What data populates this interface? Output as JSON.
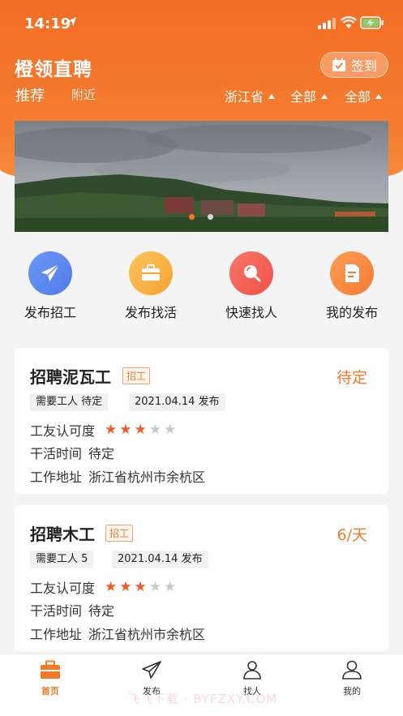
{
  "status_bar": {
    "time": "14:19"
  },
  "header": {
    "app_title": "橙领直聘",
    "checkin_label": "签到",
    "tabs": {
      "recommend": "推荐",
      "nearby": "附近"
    },
    "filters": {
      "province": "浙江省",
      "city": "全部",
      "district": "全部"
    }
  },
  "quick_actions": [
    {
      "label": "发布招工",
      "icon": "paper-plane-icon"
    },
    {
      "label": "发布找活",
      "icon": "briefcase-icon"
    },
    {
      "label": "快速找人",
      "icon": "search-icon"
    },
    {
      "label": "我的发布",
      "icon": "document-icon"
    }
  ],
  "jobs": [
    {
      "title": "招聘泥瓦工",
      "tag": "招工",
      "pay": "待定",
      "workers_needed": "需要工人 待定",
      "published": "2021.04.14 发布",
      "rating_label": "工友认可度",
      "rating": 3,
      "rating_max": 5,
      "time_label": "干活时间",
      "time_value": "待定",
      "addr_label": "工作地址",
      "addr_value": "浙江省杭州市余杭区"
    },
    {
      "title": "招聘木工",
      "tag": "招工",
      "pay": "6/天",
      "workers_needed": "需要工人 5",
      "published": "2021.04.14 发布",
      "rating_label": "工友认可度",
      "rating": 3,
      "rating_max": 5,
      "time_label": "干活时间",
      "time_value": "待定",
      "addr_label": "工作地址",
      "addr_value": "浙江省杭州市余杭区"
    }
  ],
  "tabbar": {
    "home": "首页",
    "post": "发布",
    "find": "找人",
    "mine": "我的"
  },
  "watermark": "飞飞下载 · BYFZXY.COM",
  "colors": {
    "brand": "#f57a28",
    "star_on": "#ef5a28",
    "star_off": "#c8c8c8"
  }
}
